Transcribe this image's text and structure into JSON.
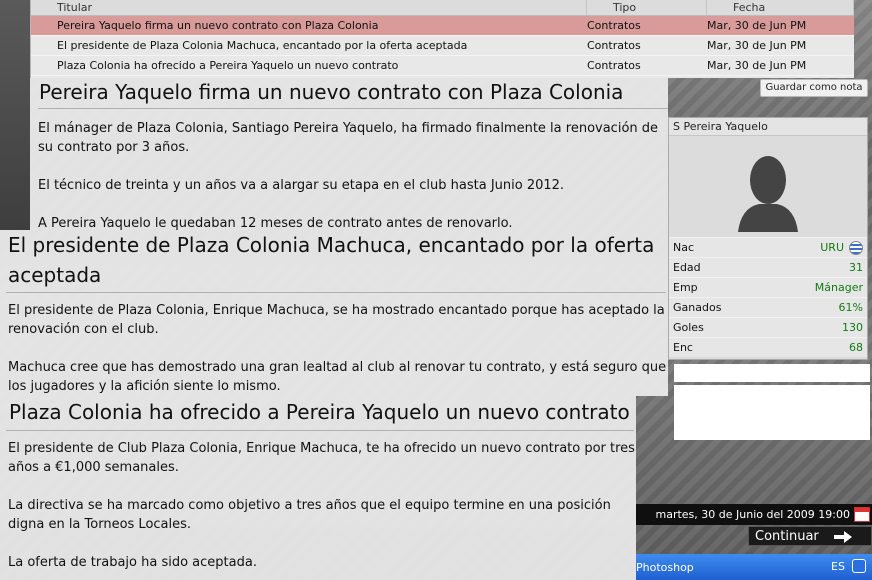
{
  "table": {
    "headers": [
      "Titular",
      "Tipo",
      "Fecha"
    ],
    "rows": [
      {
        "titular": "Pereira Yaquelo firma un nuevo contrato con Plaza Colonia",
        "tipo": "Contratos",
        "fecha": "Mar, 30 de Jun PM"
      },
      {
        "titular": "El presidente de Plaza Colonia Machuca, encantado por la oferta aceptada",
        "tipo": "Contratos",
        "fecha": "Mar, 30 de Jun PM"
      },
      {
        "titular": "Plaza Colonia ha ofrecido a Pereira Yaquelo un nuevo contrato",
        "tipo": "Contratos",
        "fecha": "Mar, 30 de Jun PM"
      }
    ]
  },
  "save_button": "Guardar como nota",
  "articles": [
    {
      "title": "Pereira Yaquelo firma un nuevo contrato con Plaza Colonia",
      "paragraphs": [
        "El mánager de Plaza Colonia, Santiago Pereira Yaquelo, ha firmado finalmente la renovación de su contrato por 3 años.",
        "El técnico de treinta y un años va a alargar su etapa en el club hasta Junio 2012.",
        "A Pereira Yaquelo le quedaban 12 meses de contrato antes de renovarlo."
      ]
    },
    {
      "title": "El presidente de Plaza Colonia Machuca, encantado por la oferta aceptada",
      "paragraphs": [
        "El presidente de Plaza Colonia, Enrique Machuca, se ha mostrado encantado porque has aceptado la renovación con el club.",
        "Machuca cree que has demostrado una gran lealtad al club al renovar tu contrato, y está seguro que los jugadores y la afición siente lo mismo."
      ]
    },
    {
      "title": "Plaza Colonia ha ofrecido a Pereira Yaquelo un nuevo contrato",
      "paragraphs": [
        "El presidente de Club Plaza Colonia, Enrique Machuca, te ha ofrecido un nuevo contrato por tres años a €1,000 semanales.",
        "La directiva se ha marcado como objetivo a tres años que el equipo termine en una posición digna en la Torneos Locales.",
        "La oferta de trabajo ha sido aceptada."
      ]
    }
  ],
  "card": {
    "name": "S Pereira Yaquelo",
    "stats": [
      {
        "label": "Nac",
        "value": "URU"
      },
      {
        "label": "Edad",
        "value": "31"
      },
      {
        "label": "Emp",
        "value": "Mánager"
      },
      {
        "label": "Ganados",
        "value": "61%"
      },
      {
        "label": "Goles",
        "value": "130"
      },
      {
        "label": "Enc",
        "value": "68"
      }
    ]
  },
  "datetime": "martes, 30 de Junio del 2009 19:00",
  "continue_label": "Continuar",
  "taskbar": {
    "task": "Photoshop",
    "lang": "ES"
  },
  "icons": [
    "calendar-icon",
    "arrow-right-icon",
    "flag-uruguay-icon",
    "player-silhouette-icon",
    "tray-icon"
  ]
}
